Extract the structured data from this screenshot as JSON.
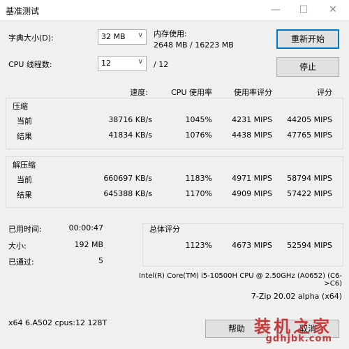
{
  "window": {
    "title": "基准测试"
  },
  "controls": {
    "dict_label": "字典大小(D):",
    "dict_value": "32 MB",
    "threads_label": "CPU 线程数:",
    "threads_value": "12",
    "threads_total": "/ 12",
    "memory_label": "内存使用:",
    "memory_value": "2648 MB / 16223 MB",
    "restart_button": "重新开始",
    "stop_button": "停止"
  },
  "table": {
    "headers": {
      "speed": "速度:",
      "cpu": "CPU 使用率",
      "rating_usage": "使用率评分",
      "rating": "评分"
    },
    "compress": {
      "title": "压缩",
      "rows": [
        {
          "label": "当前",
          "speed": "38716 KB/s",
          "cpu": "1045%",
          "rating_usage": "4231 MIPS",
          "rating": "44205 MIPS"
        },
        {
          "label": "结果",
          "speed": "41834 KB/s",
          "cpu": "1076%",
          "rating_usage": "4438 MIPS",
          "rating": "47765 MIPS"
        }
      ]
    },
    "decompress": {
      "title": "解压缩",
      "rows": [
        {
          "label": "当前",
          "speed": "660697 KB/s",
          "cpu": "1183%",
          "rating_usage": "4971 MIPS",
          "rating": "58794 MIPS"
        },
        {
          "label": "结果",
          "speed": "645388 KB/s",
          "cpu": "1170%",
          "rating_usage": "4909 MIPS",
          "rating": "57422 MIPS"
        }
      ]
    }
  },
  "stats": {
    "elapsed_label": "已用时间:",
    "elapsed_value": "00:00:47",
    "size_label": "大小:",
    "size_value": "192 MB",
    "passes_label": "已通过:",
    "passes_value": "5"
  },
  "total": {
    "title": "总体评分",
    "cpu": "1123%",
    "rating_usage": "4673 MIPS",
    "rating": "52594 MIPS"
  },
  "info": {
    "cpu_name": "Intel(R) Core(TM) i5-10500H CPU @ 2.50GHz (A0652) (C6->C6)",
    "version": "7-Zip 20.02 alpha (x64)",
    "build": "x64 6.A502 cpus:12 128T"
  },
  "footer": {
    "help_button": "帮助",
    "cancel_button": "取消"
  },
  "watermark": {
    "line1": "装机之家",
    "line2": "gdhjbk.com"
  }
}
